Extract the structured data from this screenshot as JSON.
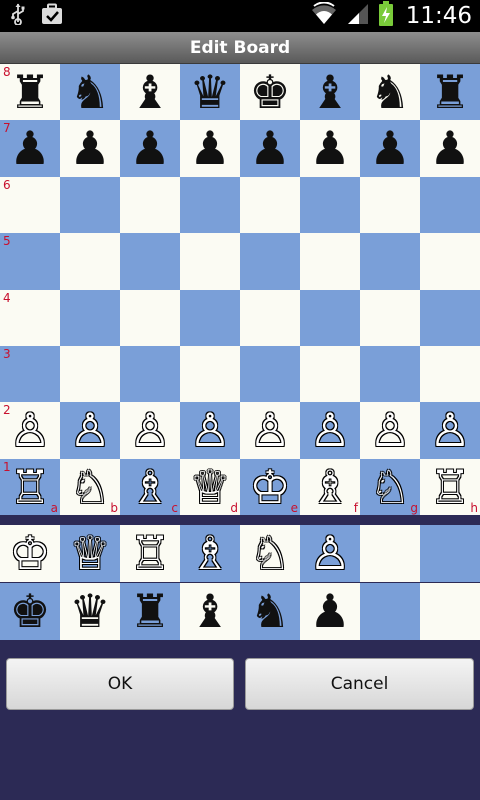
{
  "status_bar": {
    "time": "11:46",
    "icons": [
      "usb-icon",
      "task-check-icon",
      "wifi-icon",
      "signal-icon",
      "battery-charging-icon"
    ]
  },
  "title": "Edit Board",
  "board": {
    "ranks": [
      "8",
      "7",
      "6",
      "5",
      "4",
      "3",
      "2",
      "1"
    ],
    "files": [
      "a",
      "b",
      "c",
      "d",
      "e",
      "f",
      "g",
      "h"
    ],
    "rows": [
      [
        "♜",
        "♞",
        "♝",
        "♛",
        "♚",
        "♝",
        "♞",
        "♜"
      ],
      [
        "♟",
        "♟",
        "♟",
        "♟",
        "♟",
        "♟",
        "♟",
        "♟"
      ],
      [
        "",
        "",
        "",
        "",
        "",
        "",
        "",
        ""
      ],
      [
        "",
        "",
        "",
        "",
        "",
        "",
        "",
        ""
      ],
      [
        "",
        "",
        "",
        "",
        "",
        "",
        "",
        ""
      ],
      [
        "",
        "",
        "",
        "",
        "",
        "",
        "",
        ""
      ],
      [
        "♙",
        "♙",
        "♙",
        "♙",
        "♙",
        "♙",
        "♙",
        "♙"
      ],
      [
        "♖",
        "♘",
        "♗",
        "♕",
        "♔",
        "♗",
        "♘",
        "♖"
      ]
    ],
    "colors": {
      "light": "#fbfbf3",
      "dark": "#7a9fd8"
    }
  },
  "palette": {
    "rows": [
      [
        "♔",
        "♕",
        "♖",
        "♗",
        "♘",
        "♙",
        "",
        ""
      ],
      [
        "♚",
        "♛",
        "♜",
        "♝",
        "♞",
        "♟",
        "",
        ""
      ]
    ]
  },
  "buttons": {
    "ok": "OK",
    "cancel": "Cancel"
  },
  "colors": {
    "background": "#2c2a55",
    "coordinate_labels": "#c8102e"
  }
}
